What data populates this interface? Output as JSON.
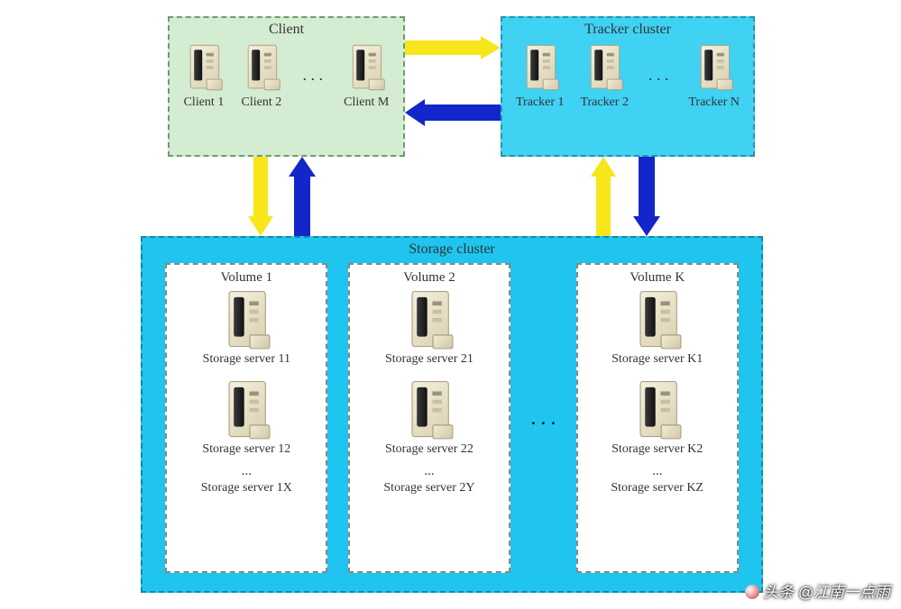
{
  "client": {
    "title": "Client",
    "nodes": [
      "Client 1",
      "Client 2",
      "Client M"
    ],
    "ellipsis": ". . ."
  },
  "tracker": {
    "title": "Tracker cluster",
    "nodes": [
      "Tracker 1",
      "Tracker 2",
      "Tracker N"
    ],
    "ellipsis": ". . ."
  },
  "storage": {
    "title": "Storage cluster",
    "ellipsis": ". . .",
    "volumes": [
      {
        "title": "Volume 1",
        "servers": [
          "Storage server 11",
          "Storage server 12"
        ],
        "ell": "...",
        "last": "Storage server 1X"
      },
      {
        "title": "Volume 2",
        "servers": [
          "Storage server 21",
          "Storage server 22"
        ],
        "ell": "...",
        "last": "Storage server 2Y"
      },
      {
        "title": "Volume K",
        "servers": [
          "Storage server K1",
          "Storage server K2"
        ],
        "ell": "...",
        "last": "Storage server KZ"
      }
    ]
  },
  "watermark": "头条 @江南一点雨"
}
